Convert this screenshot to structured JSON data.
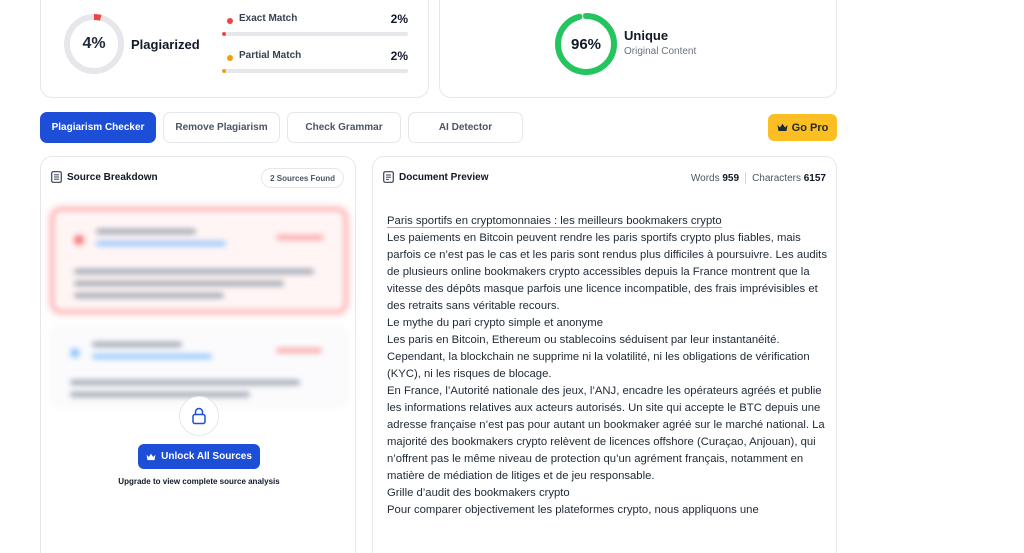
{
  "plagiarism": {
    "percent_text": "4%",
    "percent": 4,
    "label": "Plagiarized",
    "exact": {
      "label": "Exact Match",
      "value_text": "2%",
      "value": 2,
      "color": "#ef4444"
    },
    "partial": {
      "label": "Partial Match",
      "value_text": "2%",
      "value": 2,
      "color": "#f59e0b"
    },
    "ring_color": "#ef4444"
  },
  "unique": {
    "percent_text": "96%",
    "percent": 96,
    "title": "Unique",
    "subtitle": "Original Content",
    "ring_color": "#22c55e"
  },
  "tabs": [
    {
      "label": "Plagiarism Checker",
      "active": true
    },
    {
      "label": "Remove Plagiarism",
      "active": false
    },
    {
      "label": "Check Grammar",
      "active": false
    },
    {
      "label": "AI Detector",
      "active": false
    }
  ],
  "go_pro": {
    "label": "Go Pro",
    "icon": "crown-icon"
  },
  "sources": {
    "title": "Source Breakdown",
    "badge": "2 Sources Found",
    "unlock_label": "Unlock All Sources",
    "upgrade_text": "Upgrade to view complete source analysis"
  },
  "document": {
    "title": "Document Preview",
    "words_label": "Words",
    "words": "959",
    "chars_label": "Characters",
    "chars": "6157",
    "paragraphs": [
      "Paris sportifs en cryptomonnaies : les meilleurs bookmakers crypto",
      "Les paiements en Bitcoin peuvent rendre les paris sportifs crypto plus fiables, mais parfois ce n’est pas le cas et les paris sont rendus plus difficiles à poursuivre. Les audits de plusieurs online bookmakers crypto accessibles depuis la France montrent que la vitesse des dépôts masque parfois une licence incompatible, des frais imprévisibles et des retraits sans véritable recours.",
      "Le mythe du pari crypto simple et anonyme",
      "Les paris en Bitcoin, Ethereum ou stablecoins séduisent par leur instantanéité. Cependant, la blockchain ne supprime ni la volatilité, ni les obligations de vérification (KYC), ni les risques de blocage.",
      "En France, l’Autorité nationale des jeux, l’ANJ, encadre les opérateurs agréés et publie les informations relatives aux acteurs autorisés. Un site qui accepte le BTC depuis une adresse française n’est pas pour autant un bookmaker agréé sur le marché national. La majorité des bookmakers crypto relèvent de licences offshore (Curaçao, Anjouan), qui n’offrent pas le même niveau de protection qu’un agrément français, notamment en matière de médiation de litiges et de jeu responsable.",
      "Grille d’audit des bookmakers crypto",
      "Pour comparer objectivement les plateformes crypto, nous appliquons une"
    ]
  }
}
